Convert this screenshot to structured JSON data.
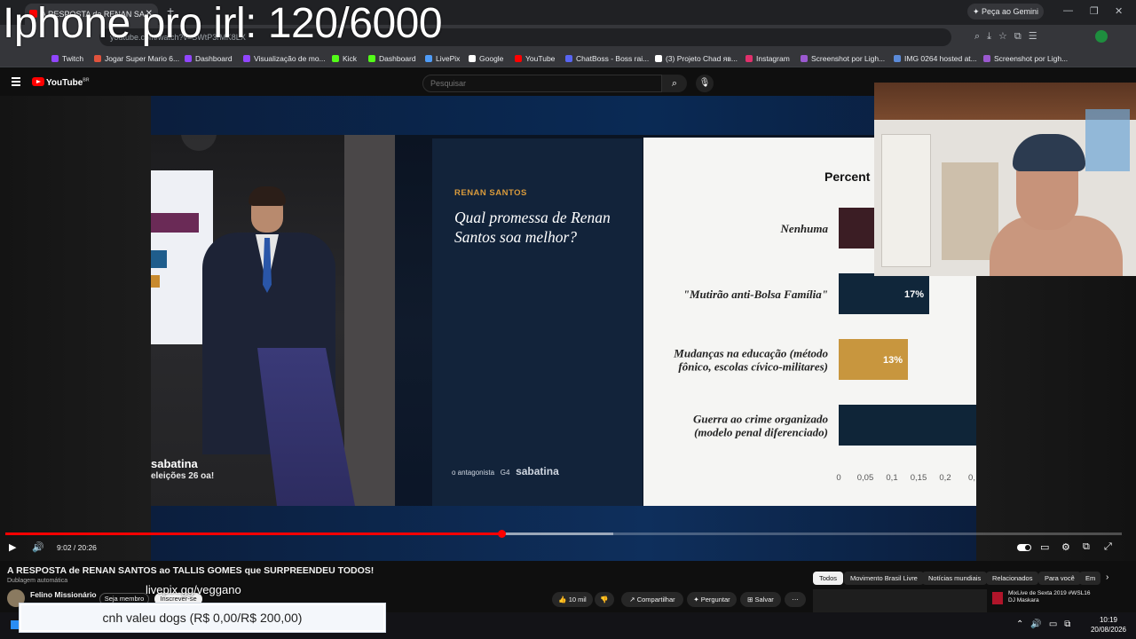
{
  "overlay": {
    "title": "Iphone pro irl: 120/6000"
  },
  "browser": {
    "tab_title": "A RESPOSTA de RENAN SA",
    "address": "youtube.com/watch?v=SWtP3rMK8LX",
    "gemini_label": "Peça ao Gemini",
    "bookmarks": [
      {
        "label": "Twitch",
        "color": "#9146ff"
      },
      {
        "label": "Jogar Super Mario 6...",
        "color": "#e0533d"
      },
      {
        "label": "Dashboard",
        "color": "#9146ff"
      },
      {
        "label": "Visualização de mo...",
        "color": "#9146ff"
      },
      {
        "label": "Kick",
        "color": "#53fc18"
      },
      {
        "label": "Dashboard",
        "color": "#53fc18"
      },
      {
        "label": "LivePix",
        "color": "#4f9cf7"
      },
      {
        "label": "Google",
        "color": "#ffffff"
      },
      {
        "label": "YouTube",
        "color": "#ff0000"
      },
      {
        "label": "ChatBoss - Boss rai...",
        "color": "#5865f2"
      },
      {
        "label": "(3) Projeto Chad яв...",
        "color": "#ffffff"
      },
      {
        "label": "Instagram",
        "color": "#e1306c"
      },
      {
        "label": "Screenshot por Ligh...",
        "color": "#9b59d0"
      },
      {
        "label": "IMG 0264 hosted at...",
        "color": "#5b8bd9"
      },
      {
        "label": "Screenshot por Ligh...",
        "color": "#9b59d0"
      }
    ]
  },
  "youtube": {
    "logo": "YouTube",
    "logo_sup": "BR",
    "search_placeholder": "Pesquisar"
  },
  "video": {
    "stage_logo_top": "sabatina",
    "stage_logo_bottom": "eleições 26 oa!",
    "question_author": "RENAN SANTOS",
    "question_text": "Qual promessa de Renan Santos soa melhor?",
    "question_footer_left": "o antagonista",
    "question_footer_mid": "G4",
    "question_footer_right": "sabatina",
    "chart_title": "Percent"
  },
  "chart_data": {
    "type": "bar",
    "orientation": "horizontal",
    "title": "Percent",
    "categories": [
      "Nenhuma",
      "\"Mutirão anti-Bolsa Família\"",
      "Mudanças na educação (método fônico, escolas cívico-militares)",
      "Guerra ao crime organizado (modelo penal diferenciado)"
    ],
    "category_lines": [
      [
        "Nenhuma"
      ],
      [
        "\"Mutirão anti-Bolsa Família\""
      ],
      [
        "Mudanças na educação (método",
        "fônico, escolas cívico-militares)"
      ],
      [
        "Guerra ao crime organizado",
        "(modelo penal diferenciado)"
      ]
    ],
    "values": [
      0.25,
      0.17,
      0.13,
      0.45
    ],
    "data_labels": [
      "",
      "17%",
      "13%",
      ""
    ],
    "colors": [
      "#3b1d24",
      "#10263a",
      "#c8963e",
      "#0f2538"
    ],
    "x_ticks": [
      "0",
      "0,05",
      "0,1",
      "0,15",
      "0,2",
      "0,"
    ],
    "xlim": [
      0,
      0.25
    ]
  },
  "player": {
    "time": "9:02 / 20:26",
    "played_fraction": 0.4441,
    "buffered_fraction": 0.5447
  },
  "meta": {
    "video_title": "A RESPOSTA de RENAN SANTOS ao TALLIS GOMES que SURPREENDEU TODOS!",
    "dubbing": "Dublagem automática",
    "channel": "Felino Missionário",
    "member_label": "Seja membro",
    "subscribe_label": "Inscrever-se",
    "likes": "10 mil",
    "share": "Compartilhar",
    "ask": "Perguntar",
    "save": "Salvar",
    "chips": [
      "Todos",
      "Movimento Brasil Livre",
      "Notícias mundiais",
      "Relacionados",
      "Para você",
      "Em"
    ],
    "rec_title": "MixLive de Sexta 2019 #WSL16 DJ Maskara"
  },
  "stream_overlay": {
    "livepix": "livepix.gg/veggano",
    "donation_goal": "cnh valeu dogs (R$ 0,00/R$ 200,00)"
  },
  "taskbar": {
    "time": "10:19",
    "date": "20/08/2026"
  }
}
